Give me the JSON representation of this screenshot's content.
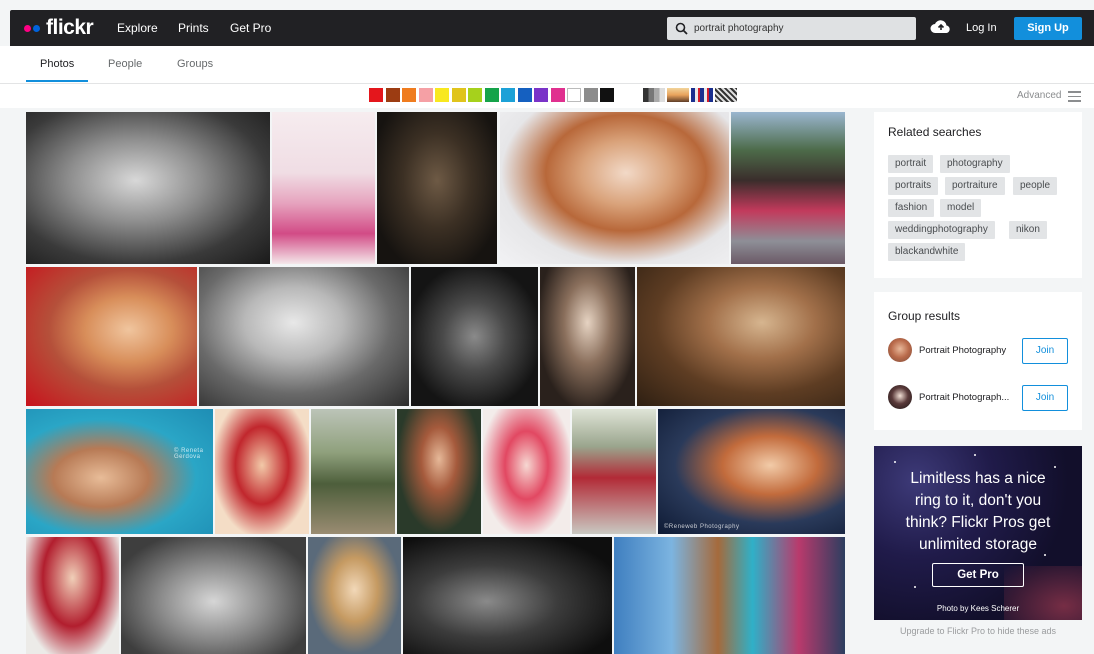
{
  "header": {
    "logo": "flickr",
    "nav": [
      "Explore",
      "Prints",
      "Get Pro"
    ],
    "search_value": "portrait photography",
    "login": "Log In",
    "signup": "Sign Up"
  },
  "tabs": [
    "Photos",
    "People",
    "Groups"
  ],
  "filters": {
    "colors": [
      "#e4161c",
      "#9c3c12",
      "#ef7c1f",
      "#f5a0a5",
      "#f8e81f",
      "#e0c41c",
      "#a6d11c",
      "#15a34a",
      "#1ca1d7",
      "#1560c0",
      "#7a33c8",
      "#e0308f",
      "#ffffff",
      "#8c8c8c",
      "#111111"
    ],
    "advanced": "Advanced"
  },
  "related": {
    "title": "Related searches",
    "tags": [
      "portrait",
      "photography",
      "portraits",
      "portraiture",
      "people",
      "fashion",
      "model",
      "weddingphotography",
      "nikon",
      "blackandwhite"
    ]
  },
  "groups": {
    "title": "Group results",
    "items": [
      {
        "name": "Portrait Photography",
        "action": "Join"
      },
      {
        "name": "Portrait Photograph...",
        "action": "Join"
      }
    ]
  },
  "ad": {
    "headline": [
      "Limitless has a nice",
      "ring to it, don't you",
      "think? Flickr Pros get",
      "unlimited storage"
    ],
    "cta": "Get Pro",
    "credit": "Photo by Kees Scherer",
    "upgrade": "Upgrade to Flickr Pro to hide these ads"
  },
  "photo_captions": {
    "p13": "© Reneta Gerdova",
    "p17": "©Reneweb Photography"
  }
}
